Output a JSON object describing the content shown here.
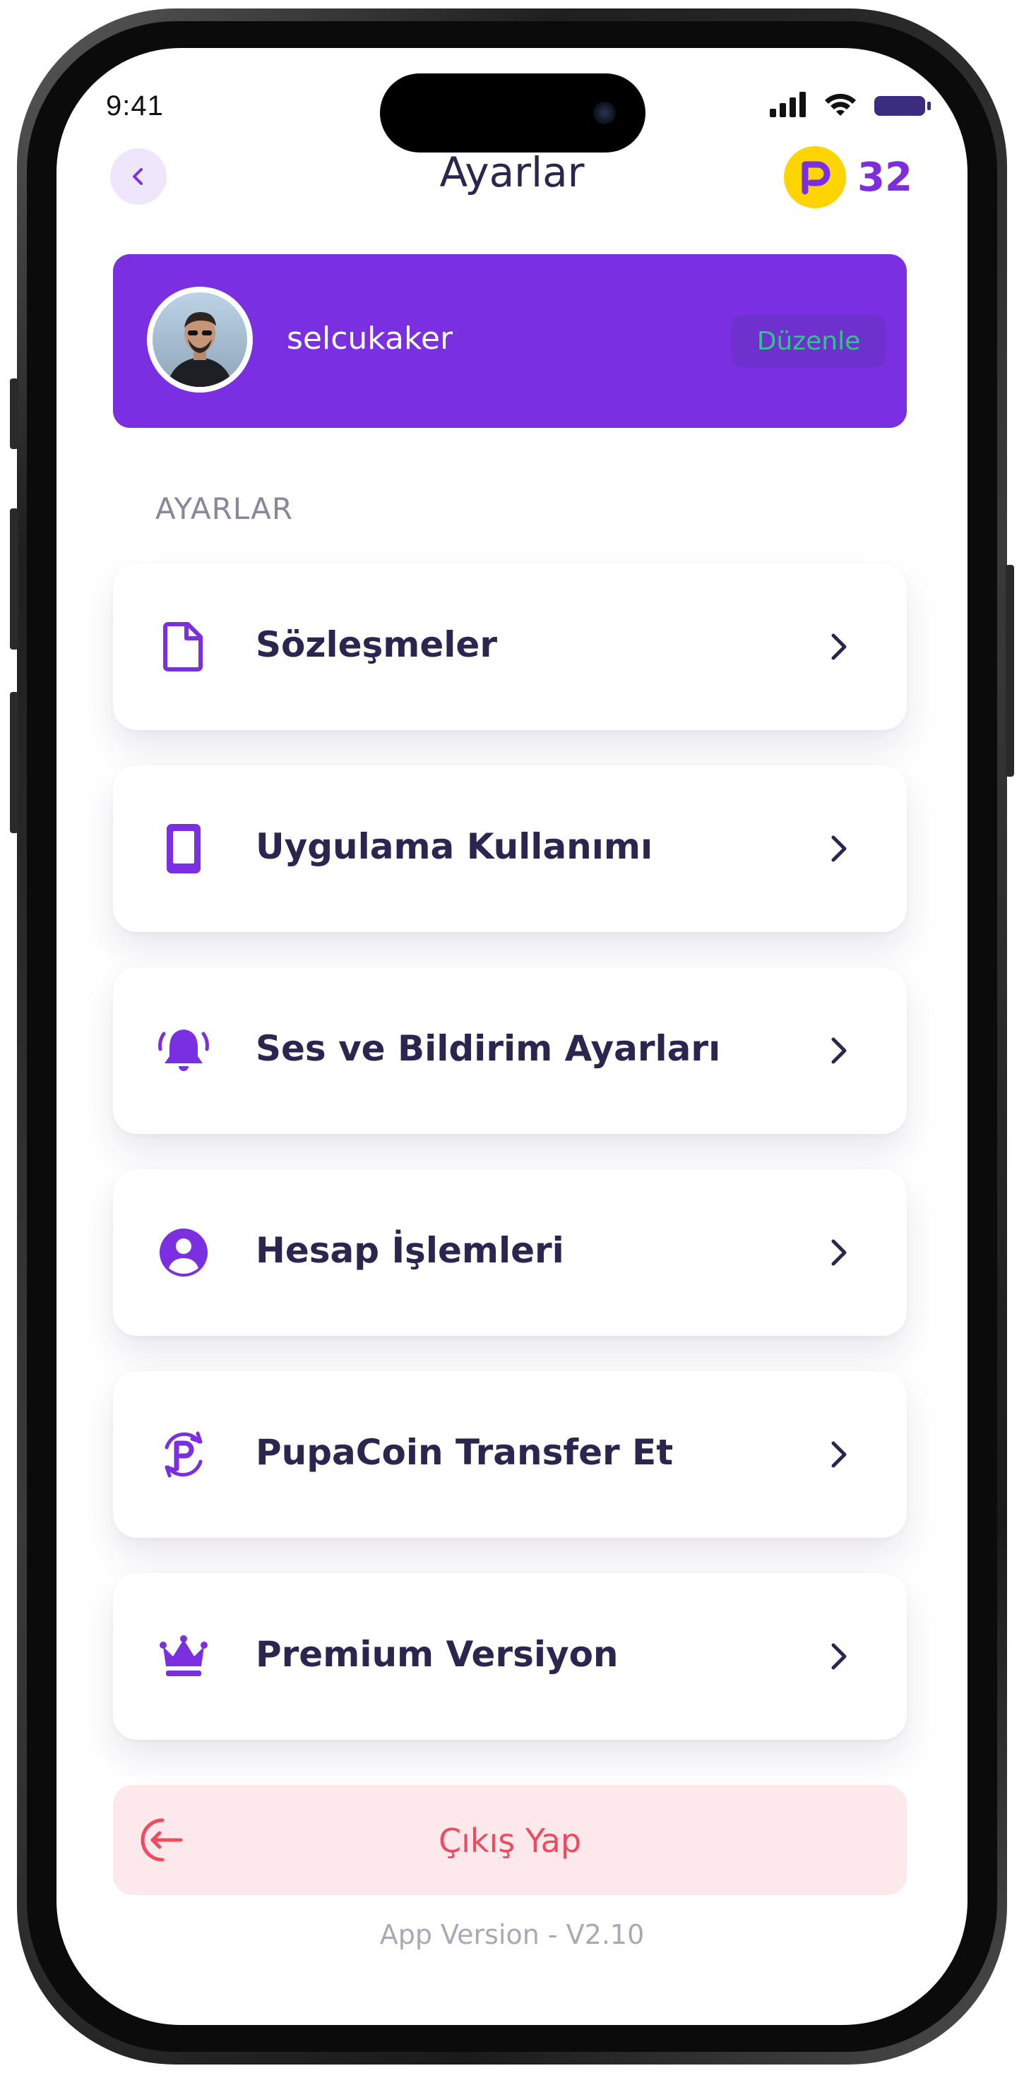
{
  "status_bar": {
    "time": "9:41"
  },
  "header": {
    "title": "Ayarlar",
    "coin_count": "32"
  },
  "profile": {
    "username": "selcukaker",
    "edit_label": "Düzenle"
  },
  "section_label": "AYARLAR",
  "menu": [
    {
      "label": "Sözleşmeler",
      "icon": "document-icon"
    },
    {
      "label": "Uygulama Kullanımı",
      "icon": "phone-icon"
    },
    {
      "label": "Ses ve Bildirim Ayarları",
      "icon": "bell-icon"
    },
    {
      "label": "Hesap İşlemleri",
      "icon": "account-icon"
    },
    {
      "label": "PupaCoin Transfer Et",
      "icon": "coin-transfer-icon"
    },
    {
      "label": "Premium Versiyon",
      "icon": "crown-icon"
    }
  ],
  "logout": {
    "label": "Çıkış Yap"
  },
  "version": "App Version - V2.10",
  "colors": {
    "accent": "#7a30e0",
    "text": "#2c2550",
    "coin": "#ffd400",
    "logout": "#f04a5e",
    "edit_text": "#2ec48a"
  }
}
